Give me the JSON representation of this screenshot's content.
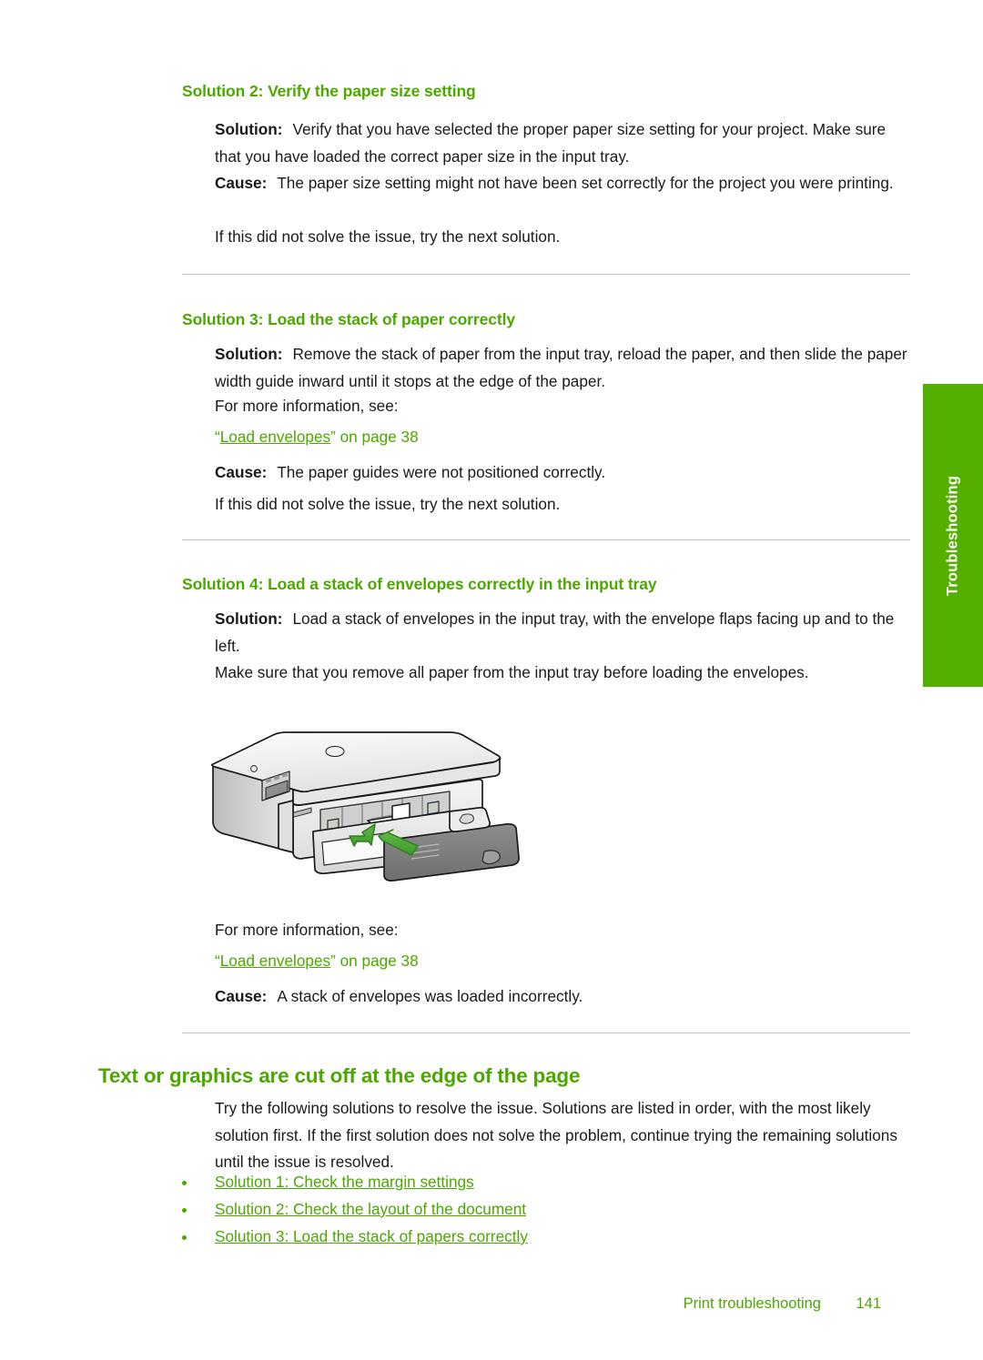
{
  "document": {
    "page_number": "141",
    "footer_title": "Print troubleshooting",
    "side_tab_label": "Troubleshooting",
    "accent_green": "#4ca800",
    "tab_green": "#54af00",
    "rule_color": "#c3c3c3"
  },
  "sections": [
    {
      "heading": "Solution 2: Verify the paper size setting",
      "solution_label": "Solution:",
      "solution_text": "Verify that you have selected the proper paper size setting for your project. Make sure that you have loaded the correct paper size in the input tray.",
      "cause_label": "Cause:",
      "cause_text": "The paper size setting might not have been set correctly for the project you were printing.",
      "next_text": "If this did not solve the issue, try the next solution."
    },
    {
      "heading": "Solution 3: Load the stack of paper correctly",
      "solution_label": "Solution:",
      "solution_text": "Remove the stack of paper from the input tray, reload the paper, and then slide the paper width guide inward until it stops at the edge of the paper.",
      "more_info": "For more information, see:",
      "xref_quote_open": "“",
      "xref_link": "Load envelopes",
      "xref_quote_close": "”",
      "xref_tail": " on page 38",
      "cause_label": "Cause:",
      "cause_text": "The paper guides were not positioned correctly.",
      "next_text": "If this did not solve the issue, try the next solution."
    },
    {
      "heading": "Solution 4: Load a stack of envelopes correctly in the input tray",
      "solution_label": "Solution:",
      "solution_text": "Load a stack of envelopes in the input tray, with the envelope flaps facing up and to the left.",
      "note_text": "Make sure that you remove all paper from the input tray before loading the envelopes.",
      "figure_alt": "hp-all-in-one-printer-loading-envelopes-illustration",
      "more_info": "For more information, see:",
      "xref_quote_open": "“",
      "xref_link": "Load envelopes",
      "xref_quote_close": "”",
      "xref_tail": " on page 38",
      "cause_label": "Cause:",
      "cause_text": "A stack of envelopes was loaded incorrectly."
    }
  ],
  "topic": {
    "heading": "Text or graphics are cut off at the edge of the page",
    "intro": "Try the following solutions to resolve the issue. Solutions are listed in order, with the most likely solution first. If the first solution does not solve the problem, continue trying the remaining solutions until the issue is resolved.",
    "links": [
      "Solution 1: Check the margin settings",
      "Solution 2: Check the layout of the document",
      "Solution 3: Load the stack of papers correctly"
    ]
  }
}
